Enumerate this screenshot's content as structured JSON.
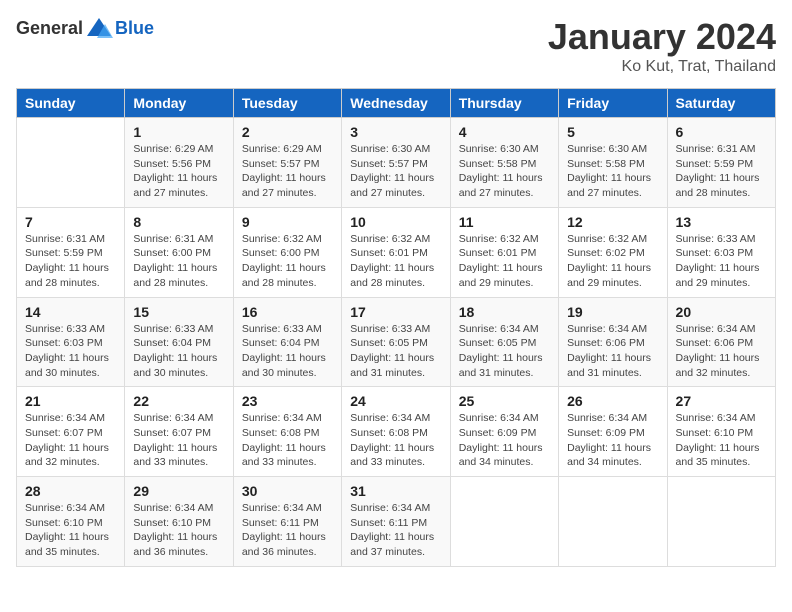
{
  "logo": {
    "general": "General",
    "blue": "Blue"
  },
  "title": "January 2024",
  "subtitle": "Ko Kut, Trat, Thailand",
  "days_of_week": [
    "Sunday",
    "Monday",
    "Tuesday",
    "Wednesday",
    "Thursday",
    "Friday",
    "Saturday"
  ],
  "weeks": [
    [
      null,
      {
        "day": "1",
        "sunrise": "6:29 AM",
        "sunset": "5:56 PM",
        "daylight": "11 hours and 27 minutes."
      },
      {
        "day": "2",
        "sunrise": "6:29 AM",
        "sunset": "5:57 PM",
        "daylight": "11 hours and 27 minutes."
      },
      {
        "day": "3",
        "sunrise": "6:30 AM",
        "sunset": "5:57 PM",
        "daylight": "11 hours and 27 minutes."
      },
      {
        "day": "4",
        "sunrise": "6:30 AM",
        "sunset": "5:58 PM",
        "daylight": "11 hours and 27 minutes."
      },
      {
        "day": "5",
        "sunrise": "6:30 AM",
        "sunset": "5:58 PM",
        "daylight": "11 hours and 27 minutes."
      },
      {
        "day": "6",
        "sunrise": "6:31 AM",
        "sunset": "5:59 PM",
        "daylight": "11 hours and 28 minutes."
      }
    ],
    [
      {
        "day": "7",
        "sunrise": "6:31 AM",
        "sunset": "5:59 PM",
        "daylight": "11 hours and 28 minutes."
      },
      {
        "day": "8",
        "sunrise": "6:31 AM",
        "sunset": "6:00 PM",
        "daylight": "11 hours and 28 minutes."
      },
      {
        "day": "9",
        "sunrise": "6:32 AM",
        "sunset": "6:00 PM",
        "daylight": "11 hours and 28 minutes."
      },
      {
        "day": "10",
        "sunrise": "6:32 AM",
        "sunset": "6:01 PM",
        "daylight": "11 hours and 28 minutes."
      },
      {
        "day": "11",
        "sunrise": "6:32 AM",
        "sunset": "6:01 PM",
        "daylight": "11 hours and 29 minutes."
      },
      {
        "day": "12",
        "sunrise": "6:32 AM",
        "sunset": "6:02 PM",
        "daylight": "11 hours and 29 minutes."
      },
      {
        "day": "13",
        "sunrise": "6:33 AM",
        "sunset": "6:03 PM",
        "daylight": "11 hours and 29 minutes."
      }
    ],
    [
      {
        "day": "14",
        "sunrise": "6:33 AM",
        "sunset": "6:03 PM",
        "daylight": "11 hours and 30 minutes."
      },
      {
        "day": "15",
        "sunrise": "6:33 AM",
        "sunset": "6:04 PM",
        "daylight": "11 hours and 30 minutes."
      },
      {
        "day": "16",
        "sunrise": "6:33 AM",
        "sunset": "6:04 PM",
        "daylight": "11 hours and 30 minutes."
      },
      {
        "day": "17",
        "sunrise": "6:33 AM",
        "sunset": "6:05 PM",
        "daylight": "11 hours and 31 minutes."
      },
      {
        "day": "18",
        "sunrise": "6:34 AM",
        "sunset": "6:05 PM",
        "daylight": "11 hours and 31 minutes."
      },
      {
        "day": "19",
        "sunrise": "6:34 AM",
        "sunset": "6:06 PM",
        "daylight": "11 hours and 31 minutes."
      },
      {
        "day": "20",
        "sunrise": "6:34 AM",
        "sunset": "6:06 PM",
        "daylight": "11 hours and 32 minutes."
      }
    ],
    [
      {
        "day": "21",
        "sunrise": "6:34 AM",
        "sunset": "6:07 PM",
        "daylight": "11 hours and 32 minutes."
      },
      {
        "day": "22",
        "sunrise": "6:34 AM",
        "sunset": "6:07 PM",
        "daylight": "11 hours and 33 minutes."
      },
      {
        "day": "23",
        "sunrise": "6:34 AM",
        "sunset": "6:08 PM",
        "daylight": "11 hours and 33 minutes."
      },
      {
        "day": "24",
        "sunrise": "6:34 AM",
        "sunset": "6:08 PM",
        "daylight": "11 hours and 33 minutes."
      },
      {
        "day": "25",
        "sunrise": "6:34 AM",
        "sunset": "6:09 PM",
        "daylight": "11 hours and 34 minutes."
      },
      {
        "day": "26",
        "sunrise": "6:34 AM",
        "sunset": "6:09 PM",
        "daylight": "11 hours and 34 minutes."
      },
      {
        "day": "27",
        "sunrise": "6:34 AM",
        "sunset": "6:10 PM",
        "daylight": "11 hours and 35 minutes."
      }
    ],
    [
      {
        "day": "28",
        "sunrise": "6:34 AM",
        "sunset": "6:10 PM",
        "daylight": "11 hours and 35 minutes."
      },
      {
        "day": "29",
        "sunrise": "6:34 AM",
        "sunset": "6:10 PM",
        "daylight": "11 hours and 36 minutes."
      },
      {
        "day": "30",
        "sunrise": "6:34 AM",
        "sunset": "6:11 PM",
        "daylight": "11 hours and 36 minutes."
      },
      {
        "day": "31",
        "sunrise": "6:34 AM",
        "sunset": "6:11 PM",
        "daylight": "11 hours and 37 minutes."
      },
      null,
      null,
      null
    ]
  ],
  "labels": {
    "sunrise": "Sunrise:",
    "sunset": "Sunset:",
    "daylight": "Daylight:"
  }
}
